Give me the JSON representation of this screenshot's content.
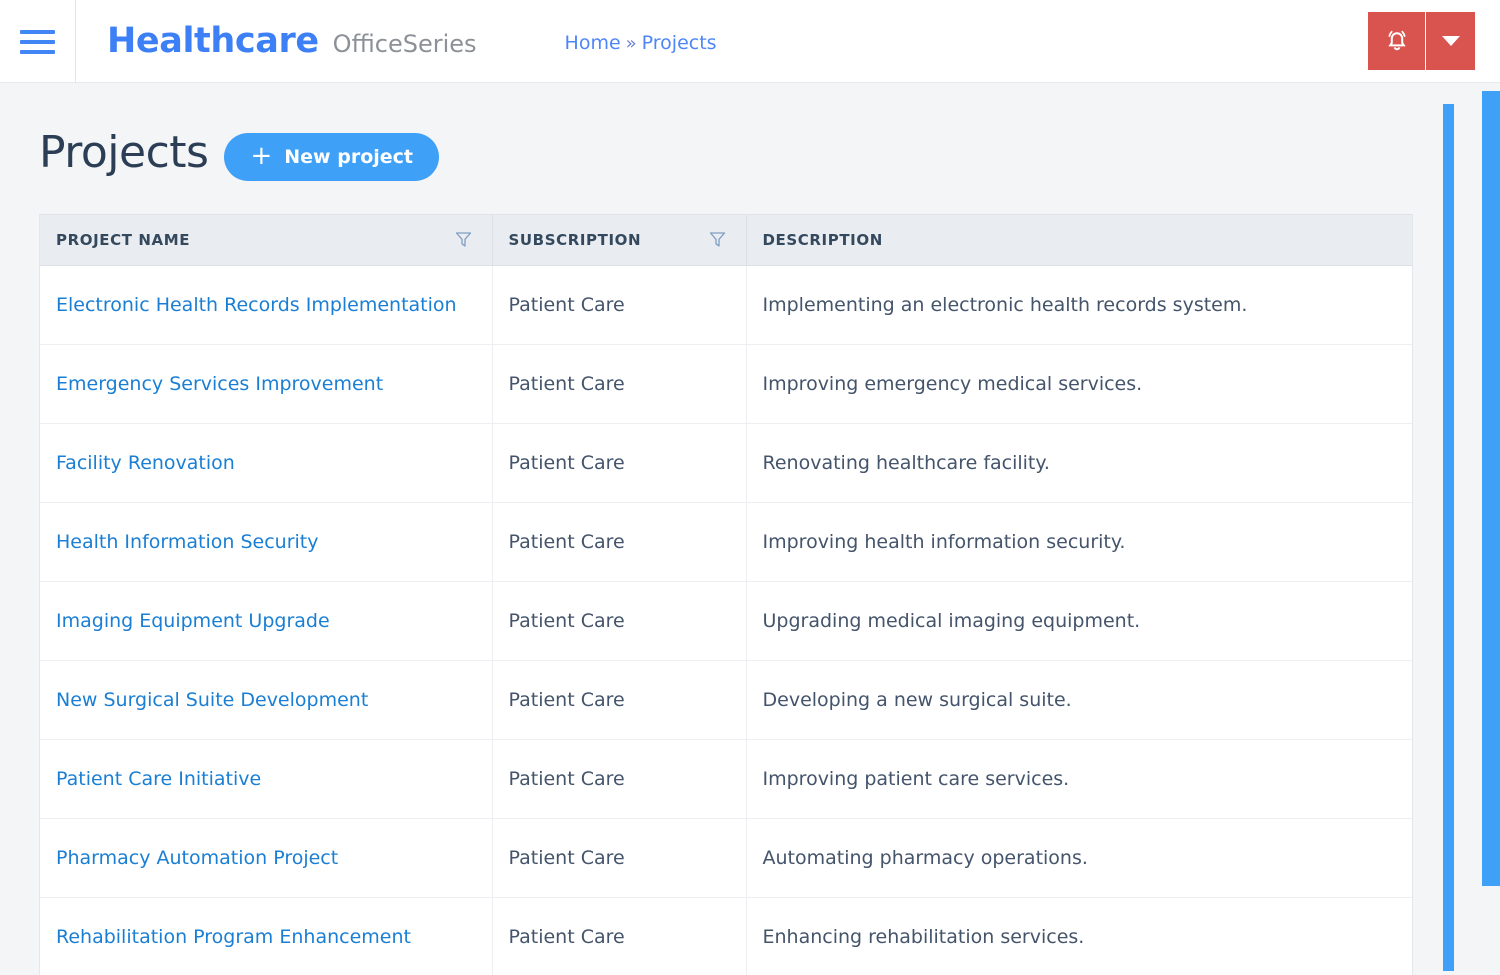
{
  "header": {
    "menu_icon": "hamburger-icon",
    "brand_main": "Healthcare",
    "brand_sub": "OfficeSeries",
    "breadcrumb": {
      "home": "Home",
      "separator": "»",
      "current": "Projects"
    },
    "notification_icon": "bell-icon",
    "notification_caret_icon": "chevron-down-icon",
    "notification_color": "#d9534f",
    "brand_color": "#3d7ff5"
  },
  "page": {
    "title": "Projects",
    "new_project_label": "New project",
    "new_project_icon": "plus-icon",
    "accent_color": "#3fa0f7"
  },
  "table": {
    "columns": [
      {
        "label": "PROJECT NAME",
        "filterable": true
      },
      {
        "label": "SUBSCRIPTION",
        "filterable": true
      },
      {
        "label": "DESCRIPTION",
        "filterable": false
      }
    ],
    "rows": [
      {
        "name": "Electronic Health Records Implementation",
        "subscription": "Patient Care",
        "description": "Implementing an electronic health records system."
      },
      {
        "name": "Emergency Services Improvement",
        "subscription": "Patient Care",
        "description": "Improving emergency medical services."
      },
      {
        "name": "Facility Renovation",
        "subscription": "Patient Care",
        "description": "Renovating healthcare facility."
      },
      {
        "name": "Health Information Security",
        "subscription": "Patient Care",
        "description": "Improving health information security."
      },
      {
        "name": "Imaging Equipment Upgrade",
        "subscription": "Patient Care",
        "description": "Upgrading medical imaging equipment."
      },
      {
        "name": "New Surgical Suite Development",
        "subscription": "Patient Care",
        "description": "Developing a new surgical suite."
      },
      {
        "name": "Patient Care Initiative",
        "subscription": "Patient Care",
        "description": "Improving patient care services."
      },
      {
        "name": "Pharmacy Automation Project",
        "subscription": "Patient Care",
        "description": "Automating pharmacy operations."
      },
      {
        "name": "Rehabilitation Program Enhancement",
        "subscription": "Patient Care",
        "description": "Enhancing rehabilitation services."
      }
    ]
  },
  "scrollbars": {
    "inner_color": "#3fa0f7",
    "outer_color": "#3fa0f7"
  }
}
